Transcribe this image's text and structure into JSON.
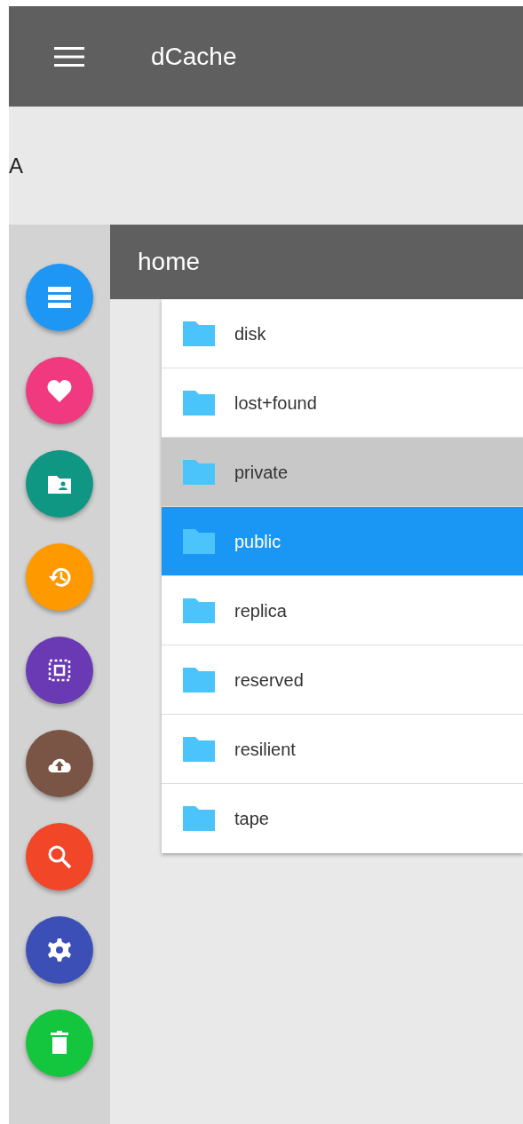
{
  "app_bar": {
    "title": "dCache"
  },
  "banner": {
    "text": "A"
  },
  "sidebar": {
    "items": [
      {
        "kind": "storage",
        "color": "#1e96f3"
      },
      {
        "kind": "heart",
        "color": "#f0397f"
      },
      {
        "kind": "shared-folder",
        "color": "#0f9784"
      },
      {
        "kind": "history",
        "color": "#fe9a00"
      },
      {
        "kind": "select",
        "color": "#6a3ab5"
      },
      {
        "kind": "upload",
        "color": "#7a5546"
      },
      {
        "kind": "search",
        "color": "#f24629"
      },
      {
        "kind": "settings",
        "color": "#3b4fb7"
      },
      {
        "kind": "trash",
        "color": "#13c63d"
      }
    ]
  },
  "folder": {
    "title": "home",
    "items": [
      {
        "name": "disk",
        "selected": false,
        "highlighted": false
      },
      {
        "name": "lost+found",
        "selected": false,
        "highlighted": false
      },
      {
        "name": "private",
        "selected": false,
        "highlighted": true
      },
      {
        "name": "public",
        "selected": true,
        "highlighted": false
      },
      {
        "name": "replica",
        "selected": false,
        "highlighted": false
      },
      {
        "name": "reserved",
        "selected": false,
        "highlighted": false
      },
      {
        "name": "resilient",
        "selected": false,
        "highlighted": false
      },
      {
        "name": "tape",
        "selected": false,
        "highlighted": false
      }
    ]
  }
}
